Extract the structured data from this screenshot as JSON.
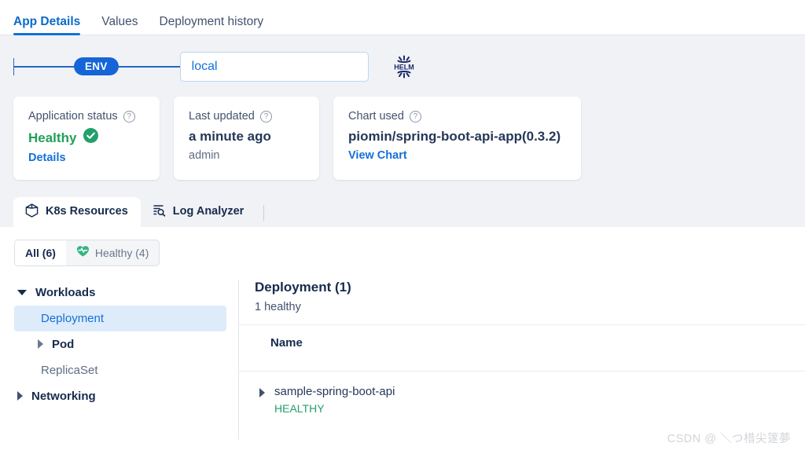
{
  "top_tabs": [
    {
      "label": "App Details",
      "active": true
    },
    {
      "label": "Values",
      "active": false
    },
    {
      "label": "Deployment history",
      "active": false
    }
  ],
  "env_bar": {
    "pill_label": "ENV",
    "input_value": "local",
    "input_placeholder": "local",
    "helm_label": "HELM"
  },
  "cards": {
    "application_status": {
      "label": "Application status",
      "value": "Healthy",
      "link": "Details",
      "status_color": "#21a05a"
    },
    "last_updated": {
      "label": "Last updated",
      "value": "a minute ago",
      "sub": "admin"
    },
    "chart_used": {
      "label": "Chart used",
      "value": "piomin/spring-boot-api-app(0.3.2)",
      "link": "View Chart"
    }
  },
  "resource_tabs": [
    {
      "label": "K8s Resources",
      "icon": "cube-icon",
      "active": true
    },
    {
      "label": "Log Analyzer",
      "icon": "log-search-icon",
      "active": false
    }
  ],
  "filters": [
    {
      "label": "All (6)",
      "active": true
    },
    {
      "label": "Healthy (4)",
      "active": false,
      "icon": "heart-pulse-icon"
    }
  ],
  "tree": [
    {
      "label": "Workloads",
      "type": "group",
      "expanded": true
    },
    {
      "label": "Deployment",
      "type": "child",
      "selected": true
    },
    {
      "label": "Pod",
      "type": "child",
      "bold": true,
      "expanded": false
    },
    {
      "label": "ReplicaSet",
      "type": "child"
    },
    {
      "label": "Networking",
      "type": "group",
      "expanded": false
    }
  ],
  "detail": {
    "title": "Deployment (1)",
    "subtitle": "1 healthy",
    "column_header": "Name",
    "rows": [
      {
        "name": "sample-spring-boot-api",
        "status": "HEALTHY"
      }
    ]
  },
  "watermark": "CSDN @ ＼つ棤尖篴夢"
}
